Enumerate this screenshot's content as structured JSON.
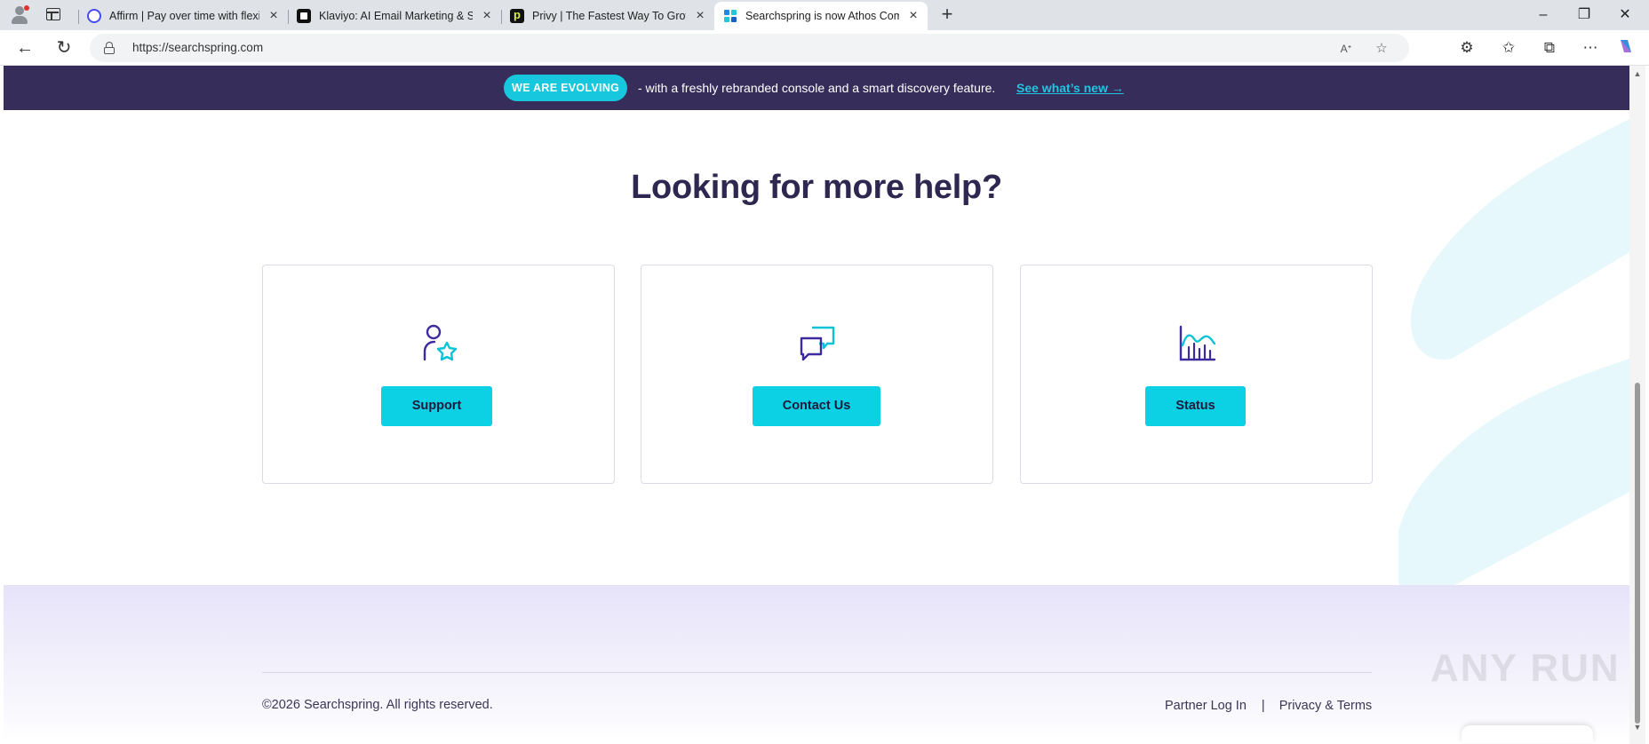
{
  "browser": {
    "tabs": [
      {
        "title": "Affirm | Pay over time with flexible",
        "favicon": "affirm-icon"
      },
      {
        "title": "Klaviyo: AI Email Marketing & SMS",
        "favicon": "klaviyo-icon"
      },
      {
        "title": "Privy | The Fastest Way To Grow Sa",
        "favicon": "privy-icon"
      },
      {
        "title": "Searchspring is now Athos Comm",
        "favicon": "searchspring-icon",
        "active": true
      }
    ],
    "url": "https://searchspring.com"
  },
  "banner": {
    "pill": "WE ARE EVOLVING",
    "text": "- with a freshly rebranded console and a smart discovery feature.",
    "link": "See what’s new →"
  },
  "help": {
    "title": "Looking for more help?",
    "cards": [
      {
        "icon": "support-person-star-icon",
        "button": "Support"
      },
      {
        "icon": "chat-bubbles-icon",
        "button": "Contact Us"
      },
      {
        "icon": "status-chart-icon",
        "button": "Status"
      }
    ]
  },
  "footer": {
    "copyright": "©2026 Searchspring. All rights reserved.",
    "links": [
      "Partner Log In",
      "Privacy & Terms"
    ],
    "divider": "|"
  },
  "watermark": "ANY RUN",
  "colors": {
    "banner_bg": "#372d5a",
    "accent_cyan": "#0cd0e3",
    "heading": "#2e2750",
    "icon_purple": "#3d2a9e"
  }
}
